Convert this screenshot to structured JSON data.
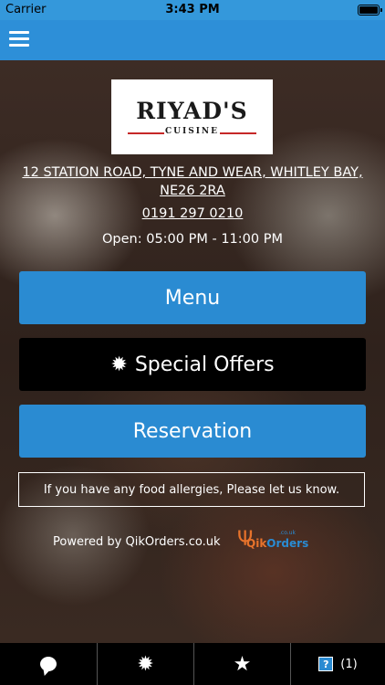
{
  "status_bar": {
    "carrier": "Carrier",
    "time": "3:43 PM"
  },
  "restaurant": {
    "logo_name": "RIYAD'S",
    "logo_sub": "CUISINE",
    "address": "12 STATION ROAD, TYNE AND WEAR, WHITLEY BAY, NE26 2RA",
    "phone": "0191 297 0210",
    "hours": "Open: 05:00 PM - 11:00 PM"
  },
  "buttons": {
    "menu": "Menu",
    "special_offers": "Special Offers",
    "reservation": "Reservation"
  },
  "allergy_notice": "If you have any food allergies, Please let us know.",
  "powered_by": "Powered by QikOrders.co.uk",
  "qik_logo": {
    "qik": "Qik",
    "orders": "Orders",
    "uk": ".co.uk"
  },
  "bottom_nav": {
    "help_count": "(1)",
    "help_glyph": "?"
  },
  "colors": {
    "accent": "#2a8bd2",
    "topbar": "#2d8fd8",
    "special": "#000000"
  }
}
